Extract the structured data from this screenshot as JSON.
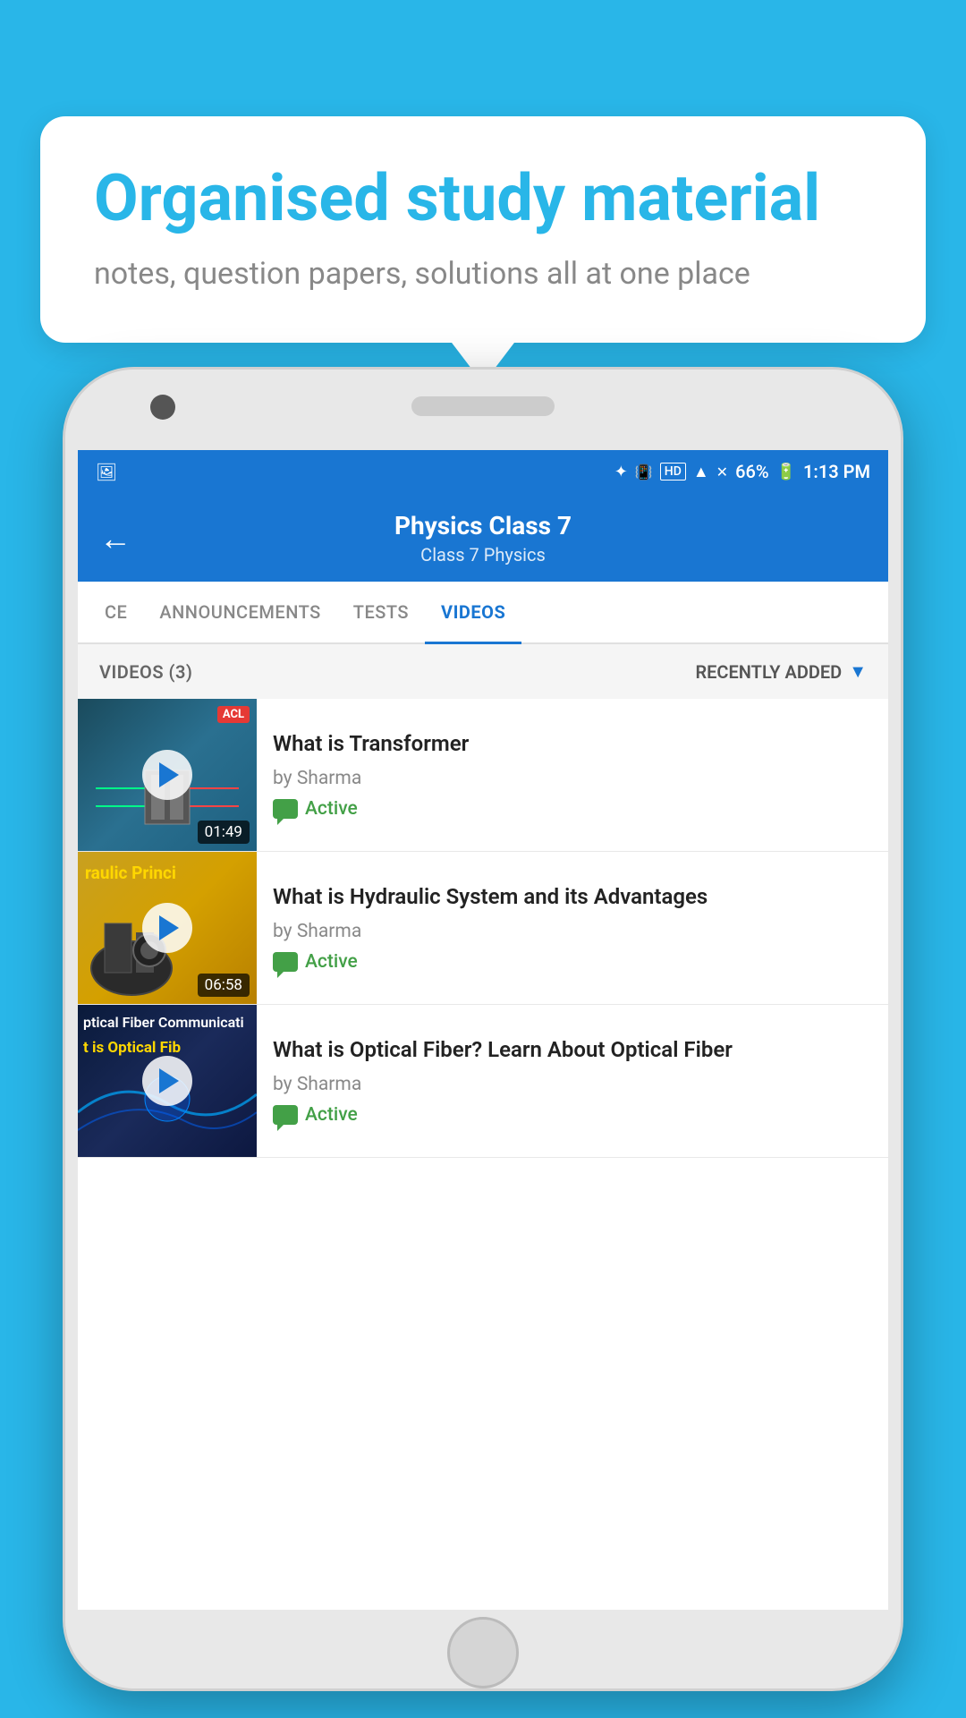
{
  "background_color": "#29b6e8",
  "speech_bubble": {
    "title": "Organised study material",
    "subtitle": "notes, question papers, solutions all at one place"
  },
  "phone": {
    "status_bar": {
      "time": "1:13 PM",
      "battery": "66%",
      "icons": [
        "bluetooth",
        "signal",
        "hd",
        "wifi",
        "network",
        "battery"
      ]
    },
    "header": {
      "back_label": "←",
      "title": "Physics Class 7",
      "breadcrumb": "Class 7   Physics"
    },
    "tabs": [
      {
        "label": "CE",
        "active": false
      },
      {
        "label": "ANNOUNCEMENTS",
        "active": false
      },
      {
        "label": "TESTS",
        "active": false
      },
      {
        "label": "VIDEOS",
        "active": true
      }
    ],
    "filter_bar": {
      "count_label": "VIDEOS (3)",
      "sort_label": "RECENTLY ADDED"
    },
    "videos": [
      {
        "title": "What is  Transformer",
        "author": "by Sharma",
        "status": "Active",
        "duration": "01:49",
        "thumbnail_type": "dark_teal",
        "acl_badge": "ACL"
      },
      {
        "title": "What is Hydraulic System and its Advantages",
        "author": "by Sharma",
        "status": "Active",
        "duration": "06:58",
        "thumbnail_type": "yellow",
        "thumbnail_text": "raulic Princi"
      },
      {
        "title": "What is Optical Fiber? Learn About Optical Fiber",
        "author": "by Sharma",
        "status": "Active",
        "duration": "",
        "thumbnail_type": "dark_blue",
        "thumbnail_text1": "ptical Fiber Communicati",
        "thumbnail_text2": "t is Optical Fib"
      }
    ]
  }
}
